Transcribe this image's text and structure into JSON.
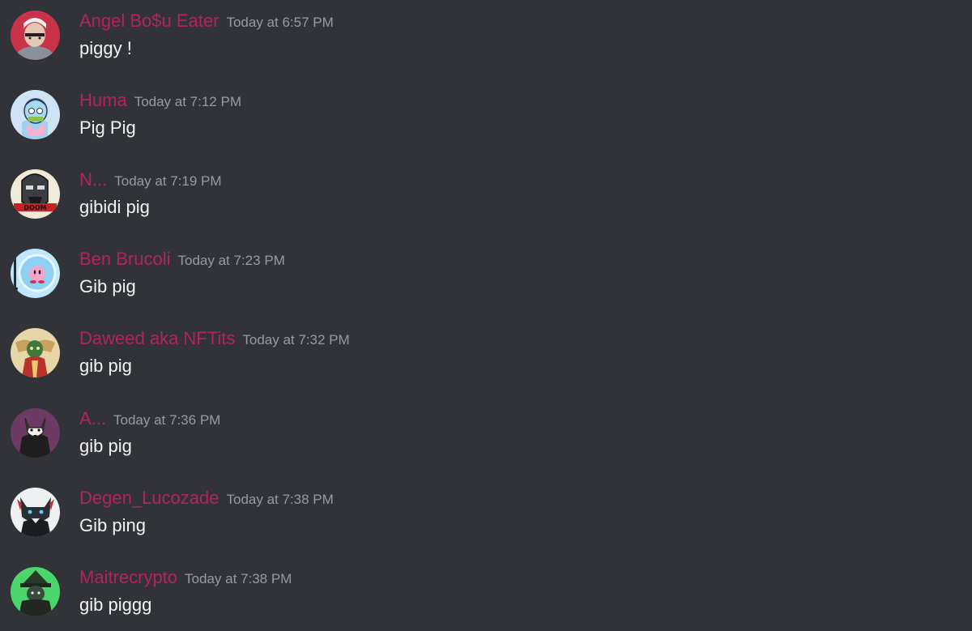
{
  "colors": {
    "background": "#313338",
    "username": "#b3245b",
    "timestamp": "#949ba4",
    "message_text": "#f2f3f5"
  },
  "messages": [
    {
      "username": "Angel Bo$u Eater",
      "timestamp": "Today at 6:57 PM",
      "content": "piggy !",
      "avatar": "avatar-red-bg-man-icon"
    },
    {
      "username": "Huma",
      "timestamp": "Today at 7:12 PM",
      "content": "Pig Pig",
      "avatar": "avatar-cartoon-ape-icon"
    },
    {
      "username": "N...",
      "timestamp": "Today at 7:19 PM",
      "content": "gibidi pig",
      "avatar": "avatar-metal-mask-icon"
    },
    {
      "username": "Ben Brucoli",
      "timestamp": "Today at 7:23 PM",
      "content": "Gib pig",
      "avatar": "avatar-kirby-bubble-icon"
    },
    {
      "username": "Daweed aka NFTits",
      "timestamp": "Today at 7:32 PM",
      "content": "gib pig",
      "avatar": "avatar-ornate-figure-icon"
    },
    {
      "username": "A...",
      "timestamp": "Today at 7:36 PM",
      "content": "gib pig",
      "avatar": "avatar-wolf-hood-icon"
    },
    {
      "username": "Degen_Lucozade",
      "timestamp": "Today at 7:38 PM",
      "content": "Gib ping",
      "avatar": "avatar-dark-wolf-icon"
    },
    {
      "username": "Maitrecrypto",
      "timestamp": "Today at 7:38 PM",
      "content": "gib piggg",
      "avatar": "avatar-green-wizard-icon"
    }
  ]
}
